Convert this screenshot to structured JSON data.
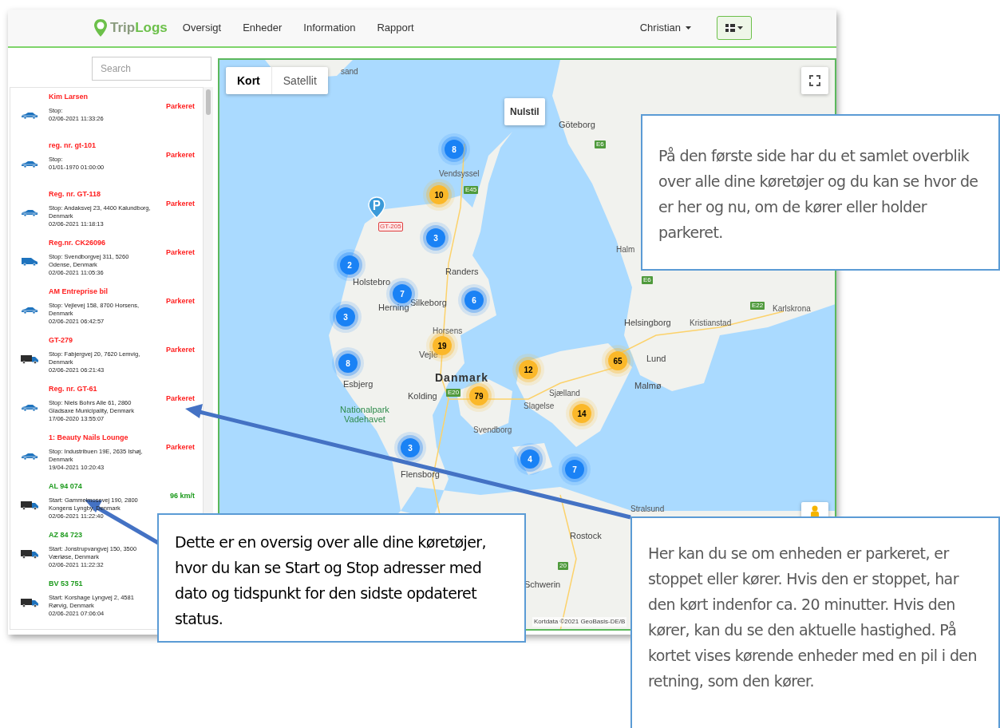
{
  "nav": {
    "logo": {
      "first": "Trip",
      "second": "Logs"
    },
    "items": [
      {
        "label": "Oversigt"
      },
      {
        "label": "Enheder"
      },
      {
        "label": "Information"
      },
      {
        "label": "Rapport"
      }
    ],
    "user": "Christian"
  },
  "search": {
    "placeholder": "Search"
  },
  "vehicles": [
    {
      "name": "Kim Larsen",
      "kind": "car",
      "color": "#ff2020",
      "address": "Stop:",
      "time": "02/06-2021 11:33:26",
      "status": "Parkeret"
    },
    {
      "name": "reg. nr. gt-101",
      "kind": "car",
      "color": "#ff2020",
      "address": "Stop:",
      "time": "01/01-1970 01:00:00",
      "status": "Parkeret"
    },
    {
      "name": "Reg. nr. GT-118",
      "kind": "car",
      "color": "#ff2020",
      "address": "Stop: Andaksvej 23, 4400 Kalundborg, Denmark",
      "time": "02/06-2021 11:18:13",
      "status": "Parkeret"
    },
    {
      "name": "Reg.nr. CK26096",
      "kind": "van",
      "color": "#ff2020",
      "address": "Stop: Svendborgvej 311, 5260 Odense, Denmark",
      "time": "02/06-2021 11:05:36",
      "status": "Parkeret"
    },
    {
      "name": "AM Entreprise bil",
      "kind": "car",
      "color": "#ff2020",
      "address": "Stop: Vejlevej 158, 8700 Horsens, Denmark",
      "time": "02/06-2021 06:42:57",
      "status": "Parkeret"
    },
    {
      "name": "GT-279",
      "kind": "truck",
      "color": "#ff2020",
      "address": "Stop: Fabjergvej 20, 7620 Lemvig, Denmark",
      "time": "02/06-2021 06:21:43",
      "status": "Parkeret"
    },
    {
      "name": "Reg. nr. GT-61",
      "kind": "car",
      "color": "#ff2020",
      "address": "Stop: Niels Bohrs Alle 61, 2860 Gladsaxe Municipality, Denmark",
      "time": "17/06-2020 13:55:07",
      "status": "Parkeret"
    },
    {
      "name": "1: Beauty Nails Lounge",
      "kind": "car",
      "color": "#ff2020",
      "address": "Stop: Industribuen 19E, 2635 Ishøj, Denmark",
      "time": "19/04-2021 10:20:43",
      "status": "Parkeret"
    },
    {
      "name": "AL 94 074",
      "kind": "truck",
      "color": "#1c9a1c",
      "address": "Start: Gammelmosevej 190, 2800 Kongens Lyngby, Denmark",
      "time": "02/06-2021 11:22:40",
      "status": "96 km/t"
    },
    {
      "name": "AZ 84 723",
      "kind": "truck",
      "color": "#1c9a1c",
      "address": "Start: Jonstrupvangvej 150, 3500 Værløse, Denmark",
      "time": "02/06-2021 11:22:32"
    },
    {
      "name": "BV 53 751",
      "kind": "truck",
      "color": "#1c9a1c",
      "address": "Start: Korshage Lyngvej 2, 4581 Rørvig, Denmark",
      "time": "02/06-2021 07:06:04"
    }
  ],
  "map": {
    "map_types": [
      {
        "label": "Kort",
        "selected": true
      },
      {
        "label": "Satellit",
        "selected": false
      }
    ],
    "reset_button": "Nulstil",
    "labels": [
      {
        "text": "sand",
        "kind": "place"
      },
      {
        "text": "Göteborg",
        "kind": "city"
      },
      {
        "text": "Vendsyssel",
        "kind": "place"
      },
      {
        "text": "Randers",
        "kind": "city"
      },
      {
        "text": "Holstebro",
        "kind": "city"
      },
      {
        "text": "Silkeborg",
        "kind": "city"
      },
      {
        "text": "Herning",
        "kind": "city"
      },
      {
        "text": "Horsens",
        "kind": "place"
      },
      {
        "text": "Vejle",
        "kind": "city"
      },
      {
        "text": "Danmark",
        "kind": "country"
      },
      {
        "text": "Esbjerg",
        "kind": "city"
      },
      {
        "text": "Kolding",
        "kind": "city"
      },
      {
        "text": "Nationalpark Vadehavet",
        "kind": "park"
      },
      {
        "text": "Svendborg",
        "kind": "place"
      },
      {
        "text": "Sjælland",
        "kind": "place"
      },
      {
        "text": "Slagelse",
        "kind": "place"
      },
      {
        "text": "Flensborg",
        "kind": "city"
      },
      {
        "text": "Rostock",
        "kind": "city"
      },
      {
        "text": "Schwerin",
        "kind": "city"
      },
      {
        "text": "Helsingborg",
        "kind": "city"
      },
      {
        "text": "Kristianstad",
        "kind": "place"
      },
      {
        "text": "Lund",
        "kind": "city"
      },
      {
        "text": "Malmø",
        "kind": "city"
      },
      {
        "text": "Karlskrona",
        "kind": "place"
      },
      {
        "text": "Halm",
        "kind": "place"
      },
      {
        "text": "Stralsund",
        "kind": "place"
      },
      {
        "text": "E45",
        "kind": "road"
      },
      {
        "text": "E6",
        "kind": "road"
      },
      {
        "text": "E6",
        "kind": "road"
      },
      {
        "text": "E20",
        "kind": "road"
      },
      {
        "text": "E22",
        "kind": "road"
      },
      {
        "text": "20",
        "kind": "road"
      }
    ],
    "pin_label": "GT-205",
    "clusters": [
      {
        "count": "8",
        "color": "#1a82f5"
      },
      {
        "count": "10",
        "color": "#fbb829"
      },
      {
        "count": "3",
        "color": "#1a82f5"
      },
      {
        "count": "2",
        "color": "#1a82f5"
      },
      {
        "count": "7",
        "color": "#1a82f5"
      },
      {
        "count": "6",
        "color": "#1a82f5"
      },
      {
        "count": "3",
        "color": "#1a82f5"
      },
      {
        "count": "19",
        "color": "#fbb829"
      },
      {
        "count": "8",
        "color": "#1a82f5"
      },
      {
        "count": "12",
        "color": "#fbb829"
      },
      {
        "count": "65",
        "color": "#fbb829"
      },
      {
        "count": "79",
        "color": "#fbb829"
      },
      {
        "count": "14",
        "color": "#fbb829"
      },
      {
        "count": "3",
        "color": "#1a82f5"
      },
      {
        "count": "4",
        "color": "#1a82f5"
      },
      {
        "count": "7",
        "color": "#1a82f5"
      }
    ],
    "attribution": "Kortdata ©2021 GeoBasis-DE/B"
  },
  "callouts": [
    {
      "text": "På den første side har du et samlet overblik over alle dine køretøjer og du kan se hvor de er her og nu, om de kører eller holder parkeret."
    },
    {
      "text": "Dette er en oversig over alle dine køretøjer, hvor du kan se Start og Stop adresser med dato og tidspunkt for den sidste opdateret status."
    },
    {
      "text": "Her kan du se om enheden er parkeret, er stoppet eller kører. Hvis den er stoppet, har den kørt indenfor ca. 20 minutter. Hvis den kører, kan du se den aktuelle hastighed. På kortet vises kørende enheder med en pil i den retning, som den kører."
    }
  ]
}
